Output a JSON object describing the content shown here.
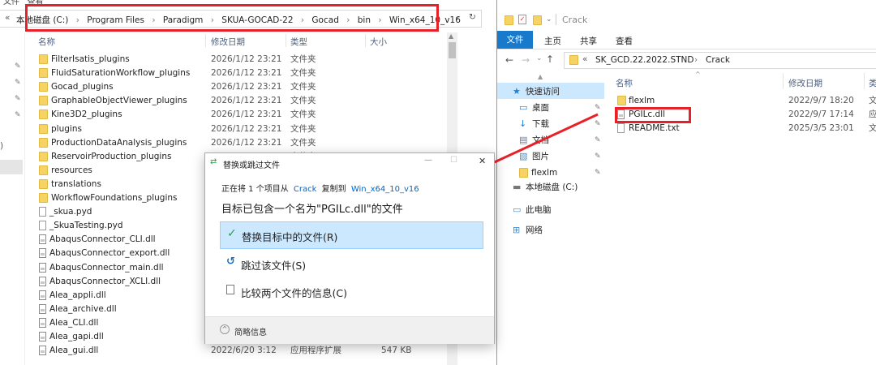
{
  "left": {
    "breadcrumb": {
      "chevron": "«",
      "parts": [
        "本地磁盘 (C:)",
        "Program Files",
        "Paradigm",
        "SKUA-GOCAD-22",
        "Gocad",
        "bin",
        "Win_x64_10_v16"
      ],
      "sep": "›"
    },
    "top_cut_label": "文件   查看",
    "headers": {
      "name": "名称",
      "date": "修改日期",
      "type": "类型",
      "size": "大小"
    },
    "rows": [
      {
        "name": "FilterIsatis_plugins",
        "date": "2026/1/12 23:21",
        "type": "文件夹",
        "size": "",
        "icon": "folder"
      },
      {
        "name": "FluidSaturationWorkflow_plugins",
        "date": "2026/1/12 23:21",
        "type": "文件夹",
        "size": "",
        "icon": "folder"
      },
      {
        "name": "Gocad_plugins",
        "date": "2026/1/12 23:21",
        "type": "文件夹",
        "size": "",
        "icon": "folder"
      },
      {
        "name": "GraphableObjectViewer_plugins",
        "date": "2026/1/12 23:21",
        "type": "文件夹",
        "size": "",
        "icon": "folder"
      },
      {
        "name": "Kine3D2_plugins",
        "date": "2026/1/12 23:21",
        "type": "文件夹",
        "size": "",
        "icon": "folder"
      },
      {
        "name": "plugins",
        "date": "2026/1/12 23:21",
        "type": "文件夹",
        "size": "",
        "icon": "folder"
      },
      {
        "name": "ProductionDataAnalysis_plugins",
        "date": "2026/1/12 23:21",
        "type": "文件夹",
        "size": "",
        "icon": "folder"
      },
      {
        "name": "ReservoirProduction_plugins",
        "date": "2026/1/12 23:21",
        "type": "文件夹",
        "size": "",
        "icon": "folder"
      },
      {
        "name": "resources",
        "date": "",
        "type": "",
        "size": "",
        "icon": "folder"
      },
      {
        "name": "translations",
        "date": "",
        "type": "",
        "size": "",
        "icon": "folder"
      },
      {
        "name": "WorkflowFoundations_plugins",
        "date": "",
        "type": "",
        "size": "",
        "icon": "folder"
      },
      {
        "name": "_skua.pyd",
        "date": "",
        "type": "",
        "size": "",
        "icon": "file"
      },
      {
        "name": "_SkuaTesting.pyd",
        "date": "",
        "type": "",
        "size": "",
        "icon": "file"
      },
      {
        "name": "AbaqusConnector_CLI.dll",
        "date": "",
        "type": "",
        "size": "",
        "icon": "dll"
      },
      {
        "name": "AbaqusConnector_export.dll",
        "date": "",
        "type": "",
        "size": "",
        "icon": "dll"
      },
      {
        "name": "AbaqusConnector_main.dll",
        "date": "",
        "type": "",
        "size": "",
        "icon": "dll"
      },
      {
        "name": "AbaqusConnector_XCLI.dll",
        "date": "",
        "type": "",
        "size": "",
        "icon": "dll"
      },
      {
        "name": "Alea_appli.dll",
        "date": "",
        "type": "",
        "size": "",
        "icon": "dll"
      },
      {
        "name": "Alea_archive.dll",
        "date": "",
        "type": "",
        "size": "",
        "icon": "dll"
      },
      {
        "name": "Alea_CLI.dll",
        "date": "",
        "type": "",
        "size": "",
        "icon": "dll"
      },
      {
        "name": "Alea_gapi.dll",
        "date": "",
        "type": "",
        "size": "",
        "icon": "dll"
      },
      {
        "name": "Alea_gui.dll",
        "date": "2022/6/20 3:12",
        "type": "应用程序扩展",
        "size": "547 KB",
        "icon": "dll"
      }
    ]
  },
  "right": {
    "title": "Crack",
    "ribbon_tabs": [
      "文件",
      "主页",
      "共享",
      "查看"
    ],
    "address": {
      "chevron": "«",
      "parts": [
        "SK_GCD.22.2022.STND",
        "Crack"
      ],
      "sep": "›"
    },
    "headers": {
      "name": "名称",
      "date": "修改日期",
      "type": "类"
    },
    "nav": [
      {
        "label": "快速访问",
        "icon": "star-icon"
      },
      {
        "label": "桌面",
        "icon": "desktop-icon"
      },
      {
        "label": "下载",
        "icon": "download-icon"
      },
      {
        "label": "文档",
        "icon": "documents-icon"
      },
      {
        "label": "图片",
        "icon": "pictures-icon"
      },
      {
        "label": "flexlm",
        "icon": "folder-icon"
      },
      {
        "label": "本地磁盘 (C:)",
        "icon": "drive-icon"
      },
      {
        "label": "此电脑",
        "icon": "pc-icon"
      },
      {
        "label": "网络",
        "icon": "network-icon"
      }
    ],
    "files": [
      {
        "name": "flexlm",
        "date": "2022/9/7 18:20",
        "type": "文",
        "icon": "folder"
      },
      {
        "name": "PGILc.dll",
        "date": "2022/9/7 17:14",
        "type": "应",
        "icon": "dll"
      },
      {
        "name": "README.txt",
        "date": "2025/3/5 23:01",
        "type": "文",
        "icon": "file"
      }
    ]
  },
  "dialog": {
    "title": "替换或跳过文件",
    "line_prefix": "正在将 1 个项目从",
    "source": "Crack",
    "line_mid": "复制到",
    "dest": "Win_x64_10_v16",
    "message": "目标已包含一个名为\"PGILc.dll\"的文件",
    "option_replace": "替换目标中的文件(R)",
    "option_skip": "跳过该文件(S)",
    "option_compare": "比较两个文件的信息(C)",
    "details": "简略信息",
    "minimize": "—",
    "maximize": "☐",
    "close": "✕"
  },
  "colors": {
    "highlight": "#e8202a",
    "selected_bg": "#cce8ff",
    "selected_border": "#99d1ff",
    "ribbon_blue": "#1979ca",
    "link": "#0066cc"
  }
}
